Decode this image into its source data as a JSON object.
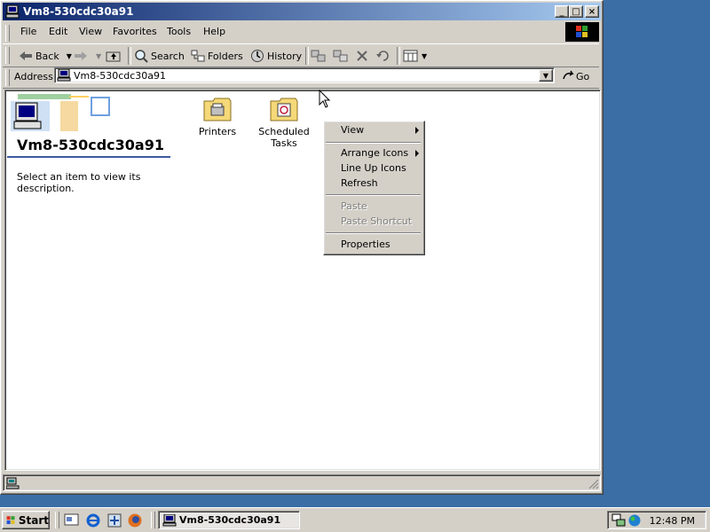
{
  "window": {
    "title": "Vm8-530cdc30a91",
    "minimize_label": "_",
    "maximize_label": "□",
    "close_label": "×"
  },
  "menubar": {
    "items": [
      "File",
      "Edit",
      "View",
      "Favorites",
      "Tools",
      "Help"
    ]
  },
  "toolbar": {
    "back": "Back",
    "search": "Search",
    "folders": "Folders",
    "history": "History"
  },
  "address": {
    "label": "Address",
    "value": "Vm8-530cdc30a91",
    "go": "Go"
  },
  "webpane": {
    "title": "Vm8-530cdc30a91",
    "description": "Select an item to view its description."
  },
  "files": [
    {
      "name": "Printers",
      "icon": "printer-folder-icon"
    },
    {
      "name": "Scheduled Tasks",
      "icon": "scheduled-tasks-folder-icon"
    }
  ],
  "context_menu": {
    "view": "View",
    "arrange_icons": "Arrange Icons",
    "line_up_icons": "Line Up Icons",
    "refresh": "Refresh",
    "paste": "Paste",
    "paste_shortcut": "Paste Shortcut",
    "properties": "Properties"
  },
  "taskbar": {
    "start": "Start",
    "task": "Vm8-530cdc30a91",
    "clock": "12:48 PM"
  },
  "colors": {
    "desktop": "#3a6ea5",
    "titlebar_start": "#0a246a",
    "titlebar_end": "#a6caf0",
    "face": "#d4d0c8"
  }
}
